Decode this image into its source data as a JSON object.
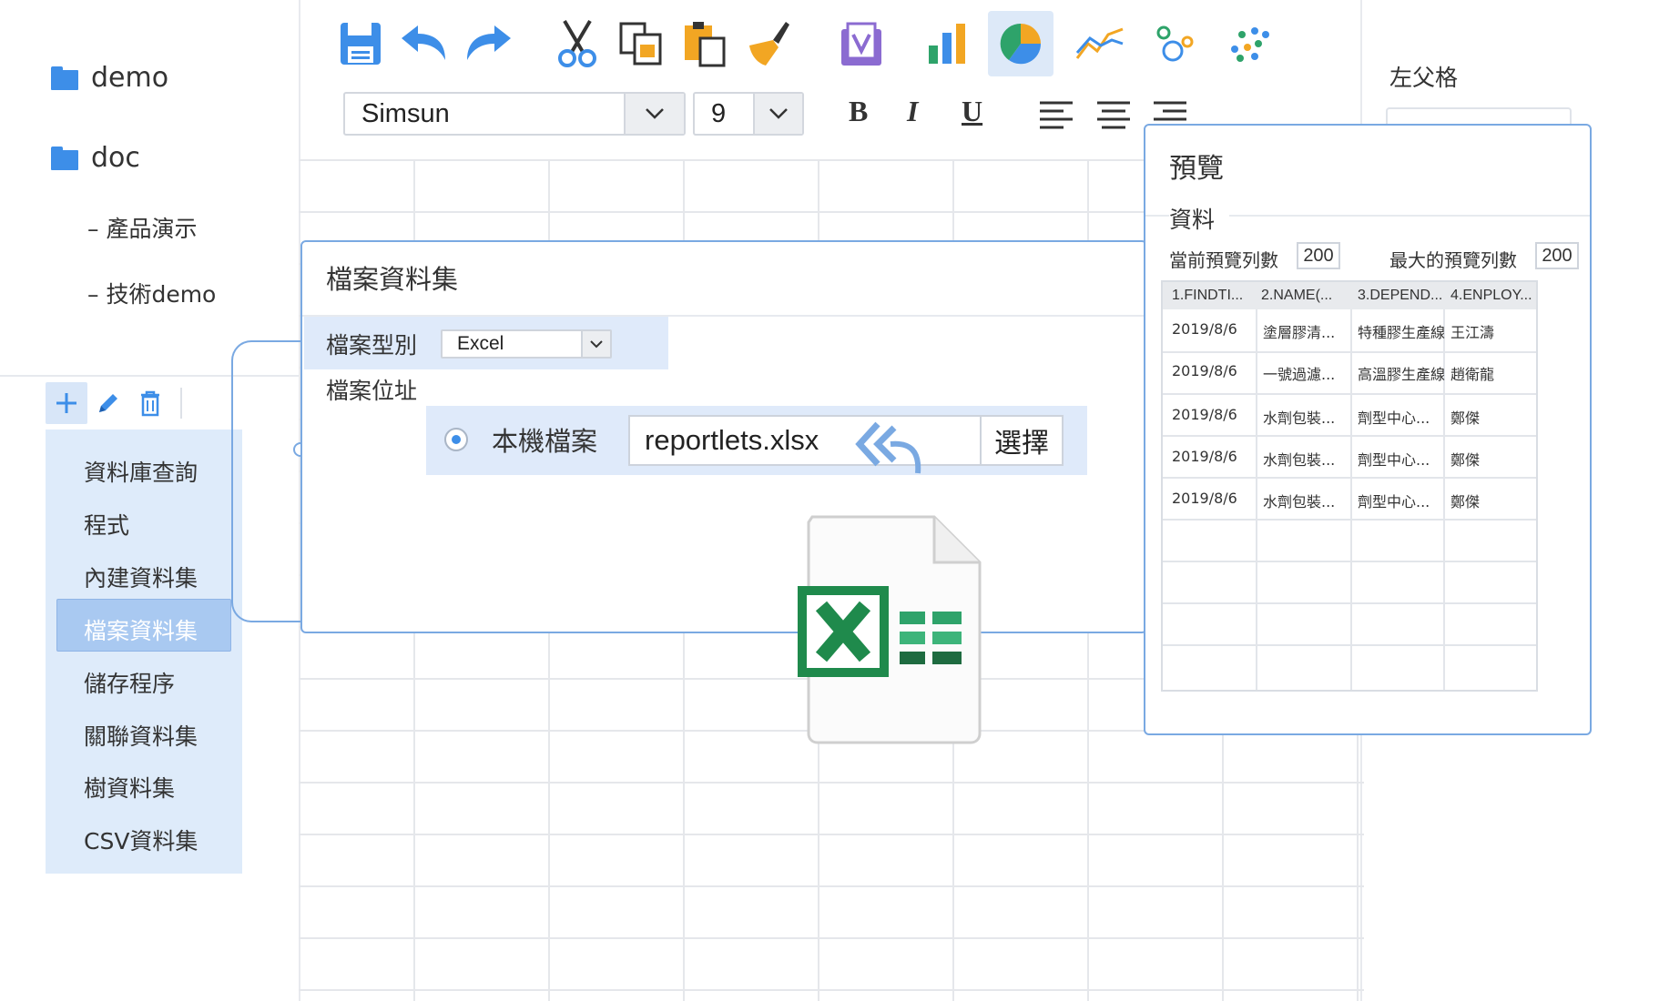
{
  "tree": {
    "folders": [
      {
        "label": "demo"
      },
      {
        "label": "doc"
      }
    ],
    "sub_items": [
      {
        "label": "– 產品演示"
      },
      {
        "label": "– 技術demo"
      }
    ]
  },
  "dataset_menu": {
    "items": [
      {
        "label": "資料庫查詢"
      },
      {
        "label": "程式"
      },
      {
        "label": "內建資料集"
      },
      {
        "label": "檔案資料集"
      },
      {
        "label": "儲存程序"
      },
      {
        "label": "關聯資料集"
      },
      {
        "label": "樹資料集"
      },
      {
        "label": "CSV資料集"
      }
    ],
    "selected_index": 3
  },
  "toolbar": {
    "font_family": "Simsun",
    "font_size": "9",
    "bold": "B",
    "italic": "I",
    "underline": "U",
    "icons": [
      "save-icon",
      "undo-icon",
      "redo-icon",
      "cut-icon",
      "copy-icon",
      "paste-icon",
      "format-brush-icon",
      "template-icon",
      "bar-chart-icon",
      "pie-chart-icon",
      "line-chart-icon",
      "bubble-chart-icon",
      "scatter-chart-icon",
      "align-left-icon",
      "align-center-icon",
      "align-right-icon"
    ],
    "selected_icon": "pie-chart-icon"
  },
  "file_dataset_dialog": {
    "title": "檔案資料集",
    "file_type_label": "檔案型別",
    "file_type_value": "Excel",
    "file_location_label": "檔案位址",
    "local_file_label": "本機檔案",
    "file_name": "reportlets.xlsx",
    "choose_button": "選擇"
  },
  "preview": {
    "title": "預覽",
    "section": "資料",
    "current_rows_label": "當前預覽列數",
    "current_rows_value": "200",
    "max_rows_label": "最大的預覽列數",
    "max_rows_value": "200",
    "columns": [
      "1.FINDTI...",
      "2.NAME(...",
      "3.DEPEND...",
      "4.ENPLOY..."
    ],
    "rows": [
      [
        "2019/8/6",
        "塗層膠清...",
        "特種膠生產線",
        "王江濤"
      ],
      [
        "2019/8/6",
        "一號過濾...",
        "高溫膠生產線",
        "趙衛龍"
      ],
      [
        "2019/8/6",
        "水劑包裝...",
        "劑型中心...",
        "鄭傑"
      ],
      [
        "2019/8/6",
        "水劑包裝...",
        "劑型中心...",
        "鄭傑"
      ],
      [
        "2019/8/6",
        "水劑包裝...",
        "劑型中心...",
        "鄭傑"
      ]
    ]
  },
  "right_panel": {
    "title": "左父格"
  },
  "colors": {
    "accent": "#3d8ee8",
    "selected_bg": "#a9c9f1",
    "menu_bg": "#deebfa",
    "excel_green": "#1f8a4c"
  }
}
